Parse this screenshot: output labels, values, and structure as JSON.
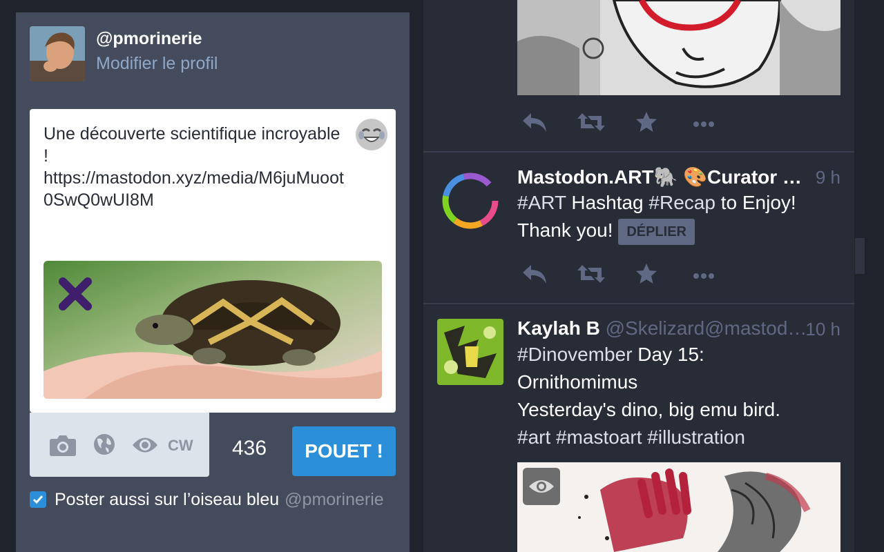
{
  "profile": {
    "username": "@pmorinerie",
    "edit_link": "Modifier le profil"
  },
  "compose": {
    "text": "Une découverte scientifique incroyable !\nhttps://mastodon.xyz/media/M6juMuoot0SwQ0wUI8M",
    "char_count": "436",
    "cw_label": "CW",
    "publish_label": "POUET !",
    "cross_post_label": "Poster aussi sur l’oiseau bleu",
    "cross_post_handle": "@pmorinerie",
    "cross_post_checked": true
  },
  "timeline": {
    "statuses": [
      {
        "name": "Mastodon.ART🐘 🎨Curator …",
        "handle": "",
        "time": "9 h",
        "content_parts": [
          "#ART",
          " ",
          "Hashtag",
          " ",
          "#Recap",
          " to Enjoy!"
        ],
        "line2": "Thank you!",
        "expand_label": "DÉPLIER"
      },
      {
        "name": "Kaylah B",
        "handle": "@Skelizard@mastod…",
        "time": "10 h",
        "line1_tag": "#Dinovember",
        "line1_rest": " Day 15:",
        "line2": "Ornithomimus",
        "line3": "Yesterday's dino, big emu bird.",
        "tags": "#art #mastoart #illustration"
      }
    ]
  },
  "colors": {
    "accent": "#2b90d9",
    "column_bg": "#444b5d",
    "timeline_bg": "#282c37",
    "muted": "#606984"
  }
}
